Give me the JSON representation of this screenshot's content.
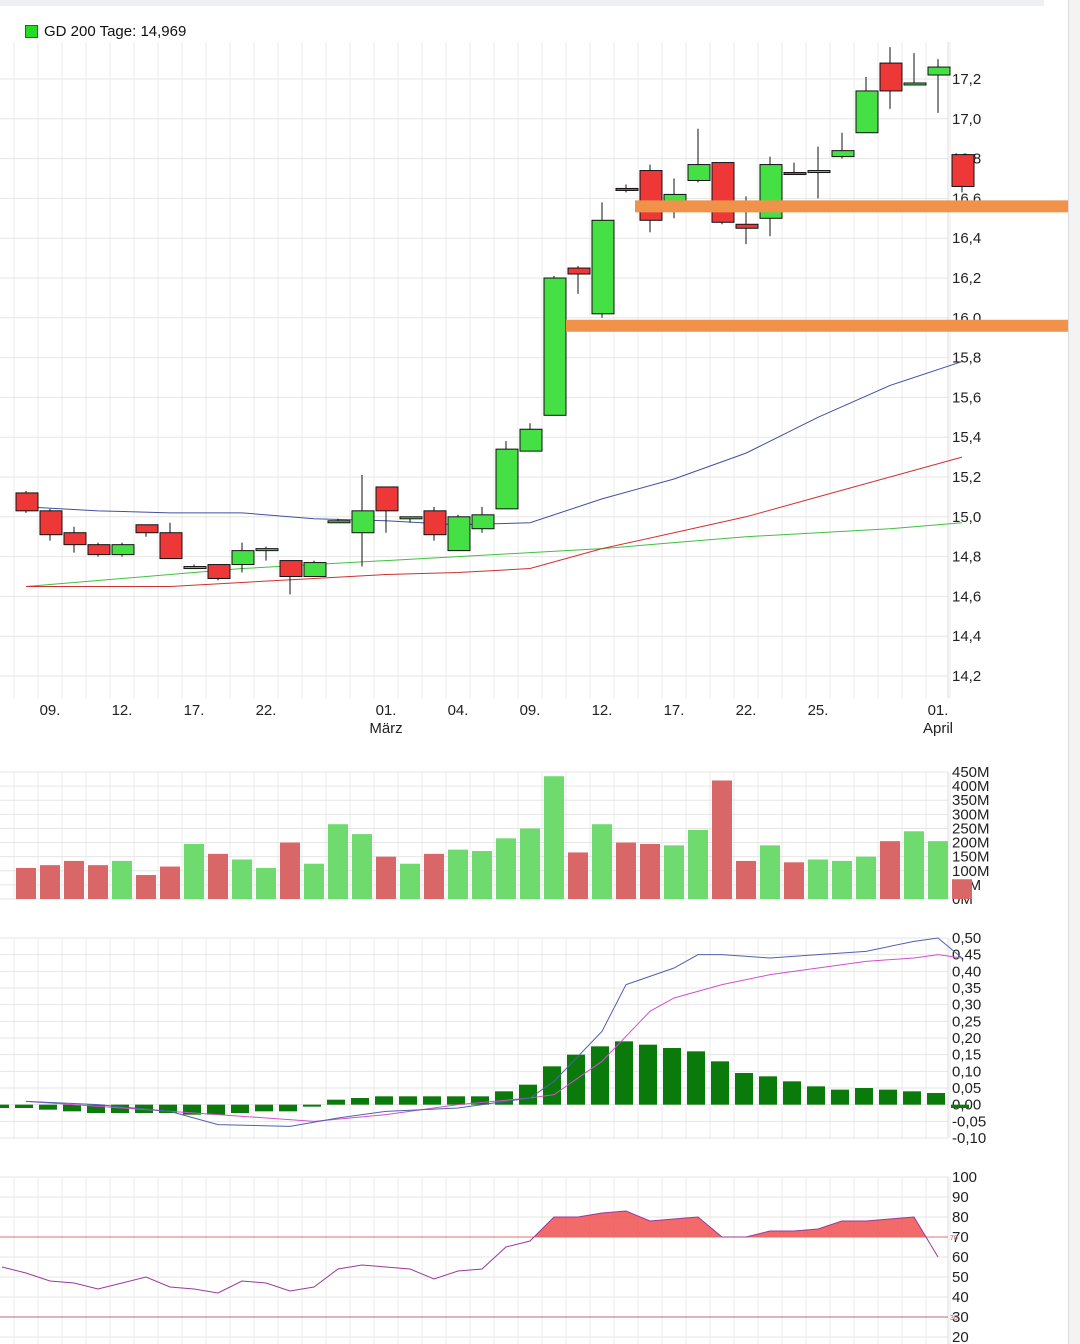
{
  "legend": {
    "label": "GD 200 Tage: 14,969",
    "color": "#22dd22"
  },
  "colors": {
    "up": "#44e044",
    "down": "#ee3838",
    "vol_up": "#6fdb6f",
    "vol_down": "#d96767",
    "sma_blue": "#4050a0",
    "sma_red": "#d03030",
    "sma_green": "#40c040",
    "support": "#f0924a",
    "macd_hist": "#0a7a0a",
    "macd": "#5060b0",
    "signal": "#d050d0",
    "rsi": "#9a3a9a",
    "rsi_fill": "#f05050",
    "rsi_line": "#e07070"
  },
  "chart_data": [
    {
      "type": "candlestick",
      "yticks": [
        "17,2",
        "17,0",
        "16,8",
        "16,6",
        "16,4",
        "16,2",
        "16,0",
        "15,8",
        "15,6",
        "15,4",
        "15,2",
        "15,0",
        "14,8",
        "14,6",
        "14,4",
        "14,2"
      ],
      "yvalues": [
        17.2,
        17.0,
        16.8,
        16.6,
        16.4,
        16.2,
        16.0,
        15.8,
        15.6,
        15.4,
        15.2,
        15.0,
        14.8,
        14.6,
        14.4,
        14.2
      ],
      "xticks": [
        {
          "day": "09.",
          "month": "",
          "i": 1
        },
        {
          "day": "12.",
          "month": "",
          "i": 4
        },
        {
          "day": "17.",
          "month": "",
          "i": 7
        },
        {
          "day": "22.",
          "month": "",
          "i": 10
        },
        {
          "day": "01.",
          "month": "März",
          "i": 15
        },
        {
          "day": "04.",
          "month": "",
          "i": 18
        },
        {
          "day": "09.",
          "month": "",
          "i": 21
        },
        {
          "day": "12.",
          "month": "",
          "i": 24
        },
        {
          "day": "17.",
          "month": "",
          "i": 27
        },
        {
          "day": "22.",
          "month": "",
          "i": 30
        },
        {
          "day": "25.",
          "month": "",
          "i": 33
        },
        {
          "day": "01.",
          "month": "April",
          "i": 38
        }
      ],
      "candles": [
        [
          15.12,
          15.13,
          15.02,
          15.03
        ],
        [
          15.03,
          15.04,
          14.88,
          14.91
        ],
        [
          14.92,
          14.95,
          14.82,
          14.86
        ],
        [
          14.86,
          14.87,
          14.8,
          14.81
        ],
        [
          14.81,
          14.87,
          14.8,
          14.86
        ],
        [
          14.96,
          14.96,
          14.9,
          14.92
        ],
        [
          14.92,
          14.97,
          14.79,
          14.79
        ],
        [
          14.75,
          14.76,
          14.74,
          14.75
        ],
        [
          14.76,
          14.76,
          14.68,
          14.69
        ],
        [
          14.76,
          14.87,
          14.72,
          14.83
        ],
        [
          14.83,
          14.85,
          14.78,
          14.84
        ],
        [
          14.78,
          14.78,
          14.61,
          14.7
        ],
        [
          14.7,
          14.78,
          14.7,
          14.77
        ],
        [
          14.98,
          14.99,
          14.97,
          14.98
        ],
        [
          14.92,
          15.21,
          14.75,
          15.03
        ],
        [
          15.15,
          15.15,
          14.92,
          15.03
        ],
        [
          14.99,
          15.0,
          14.97,
          15.0
        ],
        [
          15.03,
          15.05,
          14.88,
          14.91
        ],
        [
          14.83,
          15.01,
          14.83,
          15.0
        ],
        [
          14.94,
          15.05,
          14.92,
          15.01
        ],
        [
          15.04,
          15.38,
          15.04,
          15.34
        ],
        [
          15.33,
          15.47,
          15.33,
          15.44
        ],
        [
          15.51,
          16.21,
          15.51,
          16.2
        ],
        [
          16.25,
          16.26,
          16.12,
          16.22
        ],
        [
          16.02,
          16.58,
          16.0,
          16.49
        ],
        [
          16.65,
          16.67,
          16.63,
          16.64
        ],
        [
          16.74,
          16.77,
          16.43,
          16.49
        ],
        [
          16.56,
          16.7,
          16.5,
          16.62
        ],
        [
          16.69,
          16.95,
          16.68,
          16.77
        ],
        [
          16.78,
          16.78,
          16.47,
          16.48
        ],
        [
          16.47,
          16.61,
          16.37,
          16.45
        ],
        [
          16.5,
          16.81,
          16.41,
          16.77
        ],
        [
          16.73,
          16.78,
          16.72,
          16.72
        ],
        [
          16.74,
          16.86,
          16.6,
          16.74
        ],
        [
          16.81,
          16.93,
          16.8,
          16.84
        ],
        [
          16.93,
          17.21,
          16.93,
          17.14
        ],
        [
          17.28,
          17.36,
          17.05,
          17.14
        ],
        [
          17.18,
          17.33,
          17.18,
          17.18
        ],
        [
          17.22,
          17.3,
          17.03,
          17.26
        ],
        [
          16.82,
          16.82,
          16.63,
          16.66
        ]
      ],
      "sma_blue": [
        [
          0,
          15.05
        ],
        [
          3,
          15.03
        ],
        [
          6,
          15.02
        ],
        [
          9,
          15.02
        ],
        [
          12,
          14.99
        ],
        [
          15,
          14.98
        ],
        [
          18,
          14.96
        ],
        [
          21,
          14.97
        ],
        [
          24,
          15.09
        ],
        [
          27,
          15.19
        ],
        [
          30,
          15.32
        ],
        [
          33,
          15.5
        ],
        [
          36,
          15.66
        ],
        [
          39,
          15.78
        ]
      ],
      "sma_red": [
        [
          0,
          14.65
        ],
        [
          6,
          14.65
        ],
        [
          9,
          14.67
        ],
        [
          12,
          14.69
        ],
        [
          15,
          14.71
        ],
        [
          18,
          14.72
        ],
        [
          21,
          14.74
        ],
        [
          24,
          14.84
        ],
        [
          27,
          14.92
        ],
        [
          30,
          15.0
        ],
        [
          33,
          15.1
        ],
        [
          36,
          15.2
        ],
        [
          39,
          15.3
        ]
      ],
      "sma_green": [
        [
          0,
          14.65
        ],
        [
          3,
          14.68
        ],
        [
          6,
          14.71
        ],
        [
          9,
          14.74
        ],
        [
          12,
          14.76
        ],
        [
          15,
          14.78
        ],
        [
          18,
          14.8
        ],
        [
          21,
          14.82
        ],
        [
          24,
          14.84
        ],
        [
          27,
          14.87
        ],
        [
          30,
          14.9
        ],
        [
          33,
          14.92
        ],
        [
          36,
          14.94
        ],
        [
          39,
          14.97
        ]
      ],
      "support_levels": [
        16.56,
        15.96
      ]
    },
    {
      "type": "bar",
      "yticks": [
        "450M",
        "400M",
        "350M",
        "300M",
        "250M",
        "200M",
        "150M",
        "100M",
        "50M",
        "0M"
      ],
      "yvalues": [
        450,
        400,
        350,
        300,
        250,
        200,
        150,
        100,
        50,
        0
      ],
      "volume": [
        110,
        120,
        135,
        120,
        135,
        85,
        115,
        195,
        160,
        140,
        110,
        200,
        125,
        265,
        230,
        150,
        125,
        160,
        175,
        170,
        215,
        250,
        435,
        165,
        265,
        200,
        195,
        190,
        245,
        420,
        135,
        190,
        130,
        140,
        135,
        150,
        205,
        240,
        205,
        70
      ]
    },
    {
      "type": "bar",
      "yticks": [
        "0,50",
        "0,45",
        "0,40",
        "0,35",
        "0,30",
        "0,25",
        "0,20",
        "0,15",
        "0,10",
        "0,05",
        "0,00",
        "-0,05",
        "-0,10"
      ],
      "yvalues": [
        0.5,
        0.45,
        0.4,
        0.35,
        0.3,
        0.25,
        0.2,
        0.15,
        0.1,
        0.05,
        0.0,
        -0.05,
        -0.1
      ],
      "histogram": [
        -0.01,
        -0.01,
        -0.015,
        -0.02,
        -0.025,
        -0.025,
        -0.025,
        -0.025,
        -0.03,
        -0.03,
        -0.025,
        -0.02,
        -0.02,
        0,
        0.015,
        0.02,
        0.025,
        0.025,
        0.025,
        0.025,
        0.025,
        0.04,
        0.06,
        0.115,
        0.15,
        0.175,
        0.19,
        0.18,
        0.17,
        0.16,
        0.13,
        0.095,
        0.085,
        0.07,
        0.055,
        0.045,
        0.05,
        0.045,
        0.04,
        0.035,
        -0.01
      ],
      "macd": [
        [
          0,
          0.01
        ],
        [
          3,
          0.0
        ],
        [
          6,
          -0.02
        ],
        [
          8,
          -0.06
        ],
        [
          11,
          -0.065
        ],
        [
          13,
          -0.04
        ],
        [
          15,
          -0.02
        ],
        [
          18,
          -0.01
        ],
        [
          21,
          0.02
        ],
        [
          22,
          0.07
        ],
        [
          24,
          0.22
        ],
        [
          25,
          0.36
        ],
        [
          27,
          0.41
        ],
        [
          28,
          0.45
        ],
        [
          29,
          0.45
        ],
        [
          31,
          0.44
        ],
        [
          33,
          0.45
        ],
        [
          35,
          0.46
        ],
        [
          37,
          0.49
        ],
        [
          38,
          0.5
        ],
        [
          39,
          0.44
        ]
      ],
      "signal": [
        [
          0,
          0.01
        ],
        [
          4,
          -0.01
        ],
        [
          8,
          -0.03
        ],
        [
          12,
          -0.05
        ],
        [
          15,
          -0.03
        ],
        [
          18,
          0.0
        ],
        [
          21,
          0.02
        ],
        [
          22,
          0.03
        ],
        [
          24,
          0.13
        ],
        [
          26,
          0.28
        ],
        [
          27,
          0.32
        ],
        [
          29,
          0.36
        ],
        [
          31,
          0.39
        ],
        [
          33,
          0.41
        ],
        [
          35,
          0.43
        ],
        [
          37,
          0.44
        ],
        [
          38,
          0.45
        ],
        [
          39,
          0.44
        ]
      ]
    },
    {
      "type": "area",
      "yticks": [
        "100",
        "90",
        "80",
        "70",
        "60",
        "50",
        "40",
        "30",
        "20"
      ],
      "yvalues": [
        100,
        90,
        80,
        70,
        60,
        50,
        40,
        30,
        20
      ],
      "rsi": [
        [
          -1,
          55
        ],
        [
          0,
          52
        ],
        [
          1,
          48
        ],
        [
          2,
          47
        ],
        [
          3,
          44
        ],
        [
          4,
          47
        ],
        [
          5,
          50
        ],
        [
          6,
          45
        ],
        [
          7,
          44
        ],
        [
          8,
          42
        ],
        [
          9,
          48
        ],
        [
          10,
          47
        ],
        [
          11,
          43
        ],
        [
          12,
          45
        ],
        [
          13,
          54
        ],
        [
          14,
          56
        ],
        [
          15,
          55
        ],
        [
          16,
          54
        ],
        [
          17,
          49
        ],
        [
          18,
          53
        ],
        [
          19,
          54
        ],
        [
          20,
          65
        ],
        [
          21,
          68
        ],
        [
          22,
          80
        ],
        [
          23,
          80
        ],
        [
          24,
          82
        ],
        [
          25,
          83
        ],
        [
          26,
          78
        ],
        [
          27,
          79
        ],
        [
          28,
          80
        ],
        [
          29,
          70
        ],
        [
          30,
          70
        ],
        [
          31,
          73
        ],
        [
          32,
          73
        ],
        [
          33,
          74
        ],
        [
          34,
          78
        ],
        [
          35,
          78
        ],
        [
          36,
          79
        ],
        [
          37,
          80
        ],
        [
          38,
          60
        ]
      ],
      "rsi_levels": [
        70,
        30
      ],
      "level_labels": [
        "70",
        "30"
      ]
    }
  ]
}
